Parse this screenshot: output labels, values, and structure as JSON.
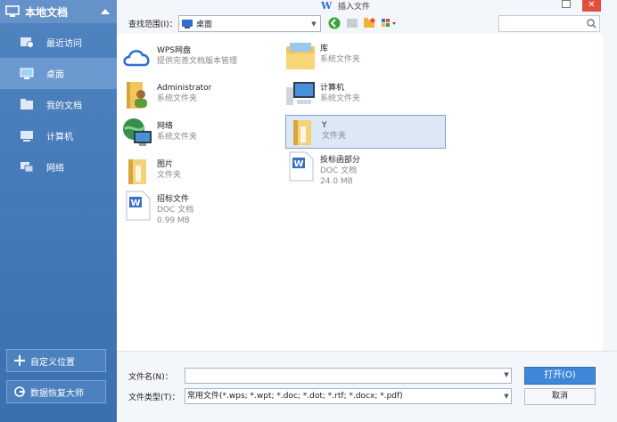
{
  "sidebar": {
    "title": "本地文档",
    "items": [
      {
        "label": "最近访问",
        "icon": "recent-icon"
      },
      {
        "label": "桌面",
        "icon": "desktop-icon",
        "active": true
      },
      {
        "label": "我的文档",
        "icon": "documents-icon"
      },
      {
        "label": "计算机",
        "icon": "computer-icon"
      },
      {
        "label": "网络",
        "icon": "network-icon"
      }
    ],
    "custom_location": "自定义位置",
    "data_recovery": "数据恢复大师"
  },
  "window": {
    "title": "插入文件",
    "logo": "W"
  },
  "toolbar": {
    "lookin_label": "查找范围(I)：",
    "lookin_value": "桌面"
  },
  "files": [
    {
      "name": "WPS网盘",
      "sub1": "提供完善文档版本管理",
      "sub2": "",
      "icon": "cloud-icon"
    },
    {
      "name": "库",
      "sub1": "系统文件夹",
      "sub2": "",
      "icon": "library-icon"
    },
    {
      "name": "Administrator",
      "sub1": "系统文件夹",
      "sub2": "",
      "icon": "user-folder-icon"
    },
    {
      "name": "计算机",
      "sub1": "系统文件夹",
      "sub2": "",
      "icon": "computer-icon"
    },
    {
      "name": "网络",
      "sub1": "系统文件夹",
      "sub2": "",
      "icon": "network-globe-icon"
    },
    {
      "name": "Y",
      "sub1": "文件夹",
      "sub2": "",
      "icon": "folder-icon",
      "selected": true
    },
    {
      "name": "图片",
      "sub1": "文件夹",
      "sub2": "",
      "icon": "folder-icon"
    },
    {
      "name": "投标函部分",
      "sub1": "DOC 文档",
      "sub2": "24.0 MB",
      "icon": "doc-icon"
    },
    {
      "name": "招标文件",
      "sub1": "DOC 文档",
      "sub2": "0.99 MB",
      "icon": "doc-icon"
    }
  ],
  "form": {
    "filename_label": "文件名(N)：",
    "filename_value": "",
    "filetype_label": "文件类型(T)：",
    "filetype_value": "常用文件(*.wps; *.wpt; *.doc; *.dot; *.rtf; *.docx; *.pdf)",
    "open_label": "打开(O)",
    "cancel_label": "取消"
  },
  "colors": {
    "sidebar": "#4a7fbf",
    "accent": "#3f87d9",
    "close": "#e04e3d"
  }
}
